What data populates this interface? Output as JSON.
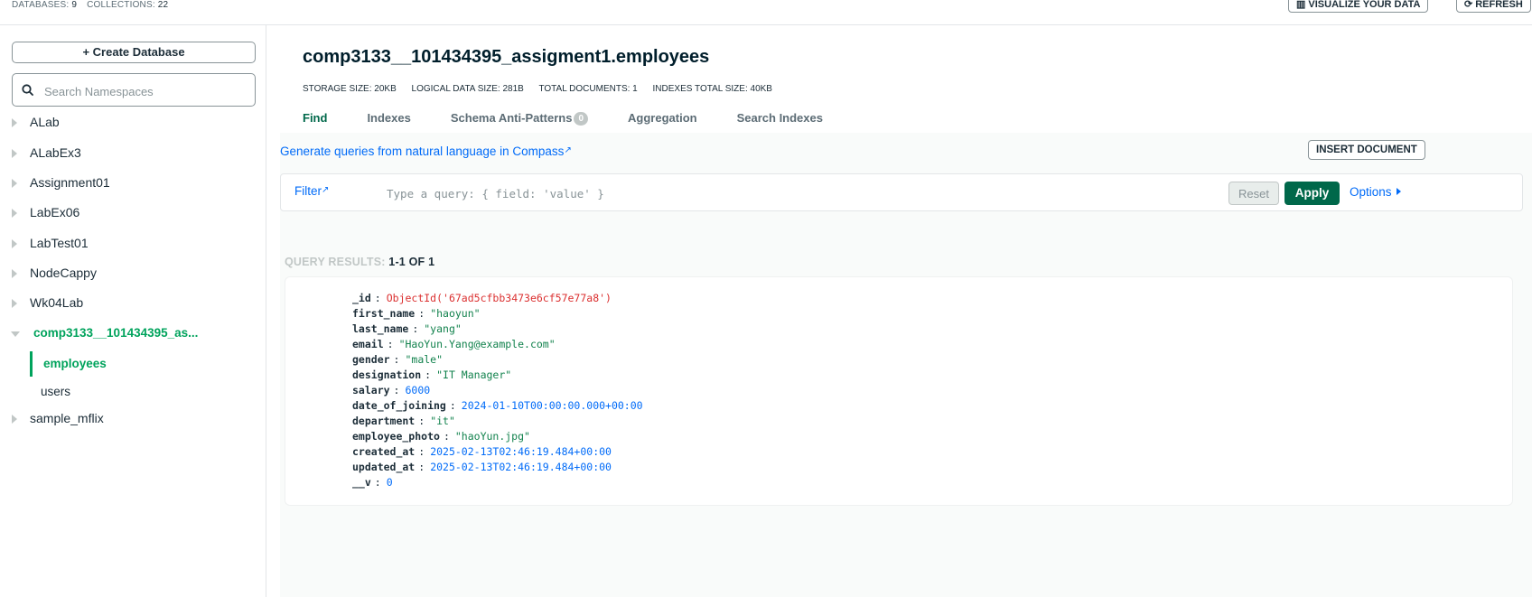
{
  "header": {
    "databases_label": "DATABASES:",
    "databases_count": "9",
    "collections_label": "COLLECTIONS:",
    "collections_count": "22",
    "visualize_label": "VISUALIZE YOUR DATA",
    "refresh_label": "REFRESH"
  },
  "sidebar": {
    "create_db_label": "Create Database",
    "search_placeholder": "Search Namespaces",
    "databases": [
      {
        "label": "ALab"
      },
      {
        "label": "ALabEx3"
      },
      {
        "label": "Assignment01"
      },
      {
        "label": "LabEx06"
      },
      {
        "label": "LabTest01"
      },
      {
        "label": "NodeCappy"
      },
      {
        "label": "Wk04Lab"
      },
      {
        "label": "comp3133__101434395_as...",
        "expanded": true
      },
      {
        "label": "sample_mflix"
      }
    ],
    "collections": [
      {
        "label": "employees",
        "active": true
      },
      {
        "label": "users"
      }
    ]
  },
  "main": {
    "title": "comp3133__101434395_assigment1.employees",
    "meta": {
      "storage": "STORAGE SIZE: 20KB",
      "logical": "LOGICAL DATA SIZE: 281B",
      "total_docs": "TOTAL DOCUMENTS: 1",
      "indexes_size": "INDEXES TOTAL SIZE: 40KB"
    },
    "tabs": [
      {
        "label": "Find"
      },
      {
        "label": "Indexes"
      },
      {
        "label": "Schema Anti-Patterns",
        "badge": "0"
      },
      {
        "label": "Aggregation"
      },
      {
        "label": "Search Indexes"
      }
    ],
    "nl_link": "Generate queries from natural language in Compass",
    "insert_label": "INSERT DOCUMENT",
    "filter": {
      "label": "Filter",
      "placeholder": "Type a query: { field: 'value' }",
      "reset_label": "Reset",
      "apply_label": "Apply",
      "options_label": "Options"
    },
    "results_label": "QUERY RESULTS:",
    "results_count": "1-1 OF 1",
    "document": [
      {
        "key": "_id",
        "value": "ObjectId('67ad5cfbb3473e6cf57e77a8')",
        "type": "oid"
      },
      {
        "key": "first_name",
        "value": "\"haoyun\"",
        "type": "str"
      },
      {
        "key": "last_name",
        "value": "\"yang\"",
        "type": "str"
      },
      {
        "key": "email",
        "value": "\"HaoYun.Yang@example.com\"",
        "type": "str"
      },
      {
        "key": "gender",
        "value": "\"male\"",
        "type": "str"
      },
      {
        "key": "designation",
        "value": "\"IT Manager\"",
        "type": "str"
      },
      {
        "key": "salary",
        "value": "6000",
        "type": "num"
      },
      {
        "key": "date_of_joining",
        "value": "2024-01-10T00:00:00.000+00:00",
        "type": "date"
      },
      {
        "key": "department",
        "value": "\"it\"",
        "type": "str"
      },
      {
        "key": "employee_photo",
        "value": "\"haoYun.jpg\"",
        "type": "str"
      },
      {
        "key": "created_at",
        "value": "2025-02-13T02:46:19.484+00:00",
        "type": "date"
      },
      {
        "key": "updated_at",
        "value": "2025-02-13T02:46:19.484+00:00",
        "type": "date"
      },
      {
        "key": "__v",
        "value": "0",
        "type": "num"
      }
    ]
  },
  "colors": {
    "accent_green": "#00a35c",
    "apply_green": "#00684a",
    "link_blue": "#016bf8",
    "oid_red": "#db3030",
    "string_green": "#12824d"
  }
}
